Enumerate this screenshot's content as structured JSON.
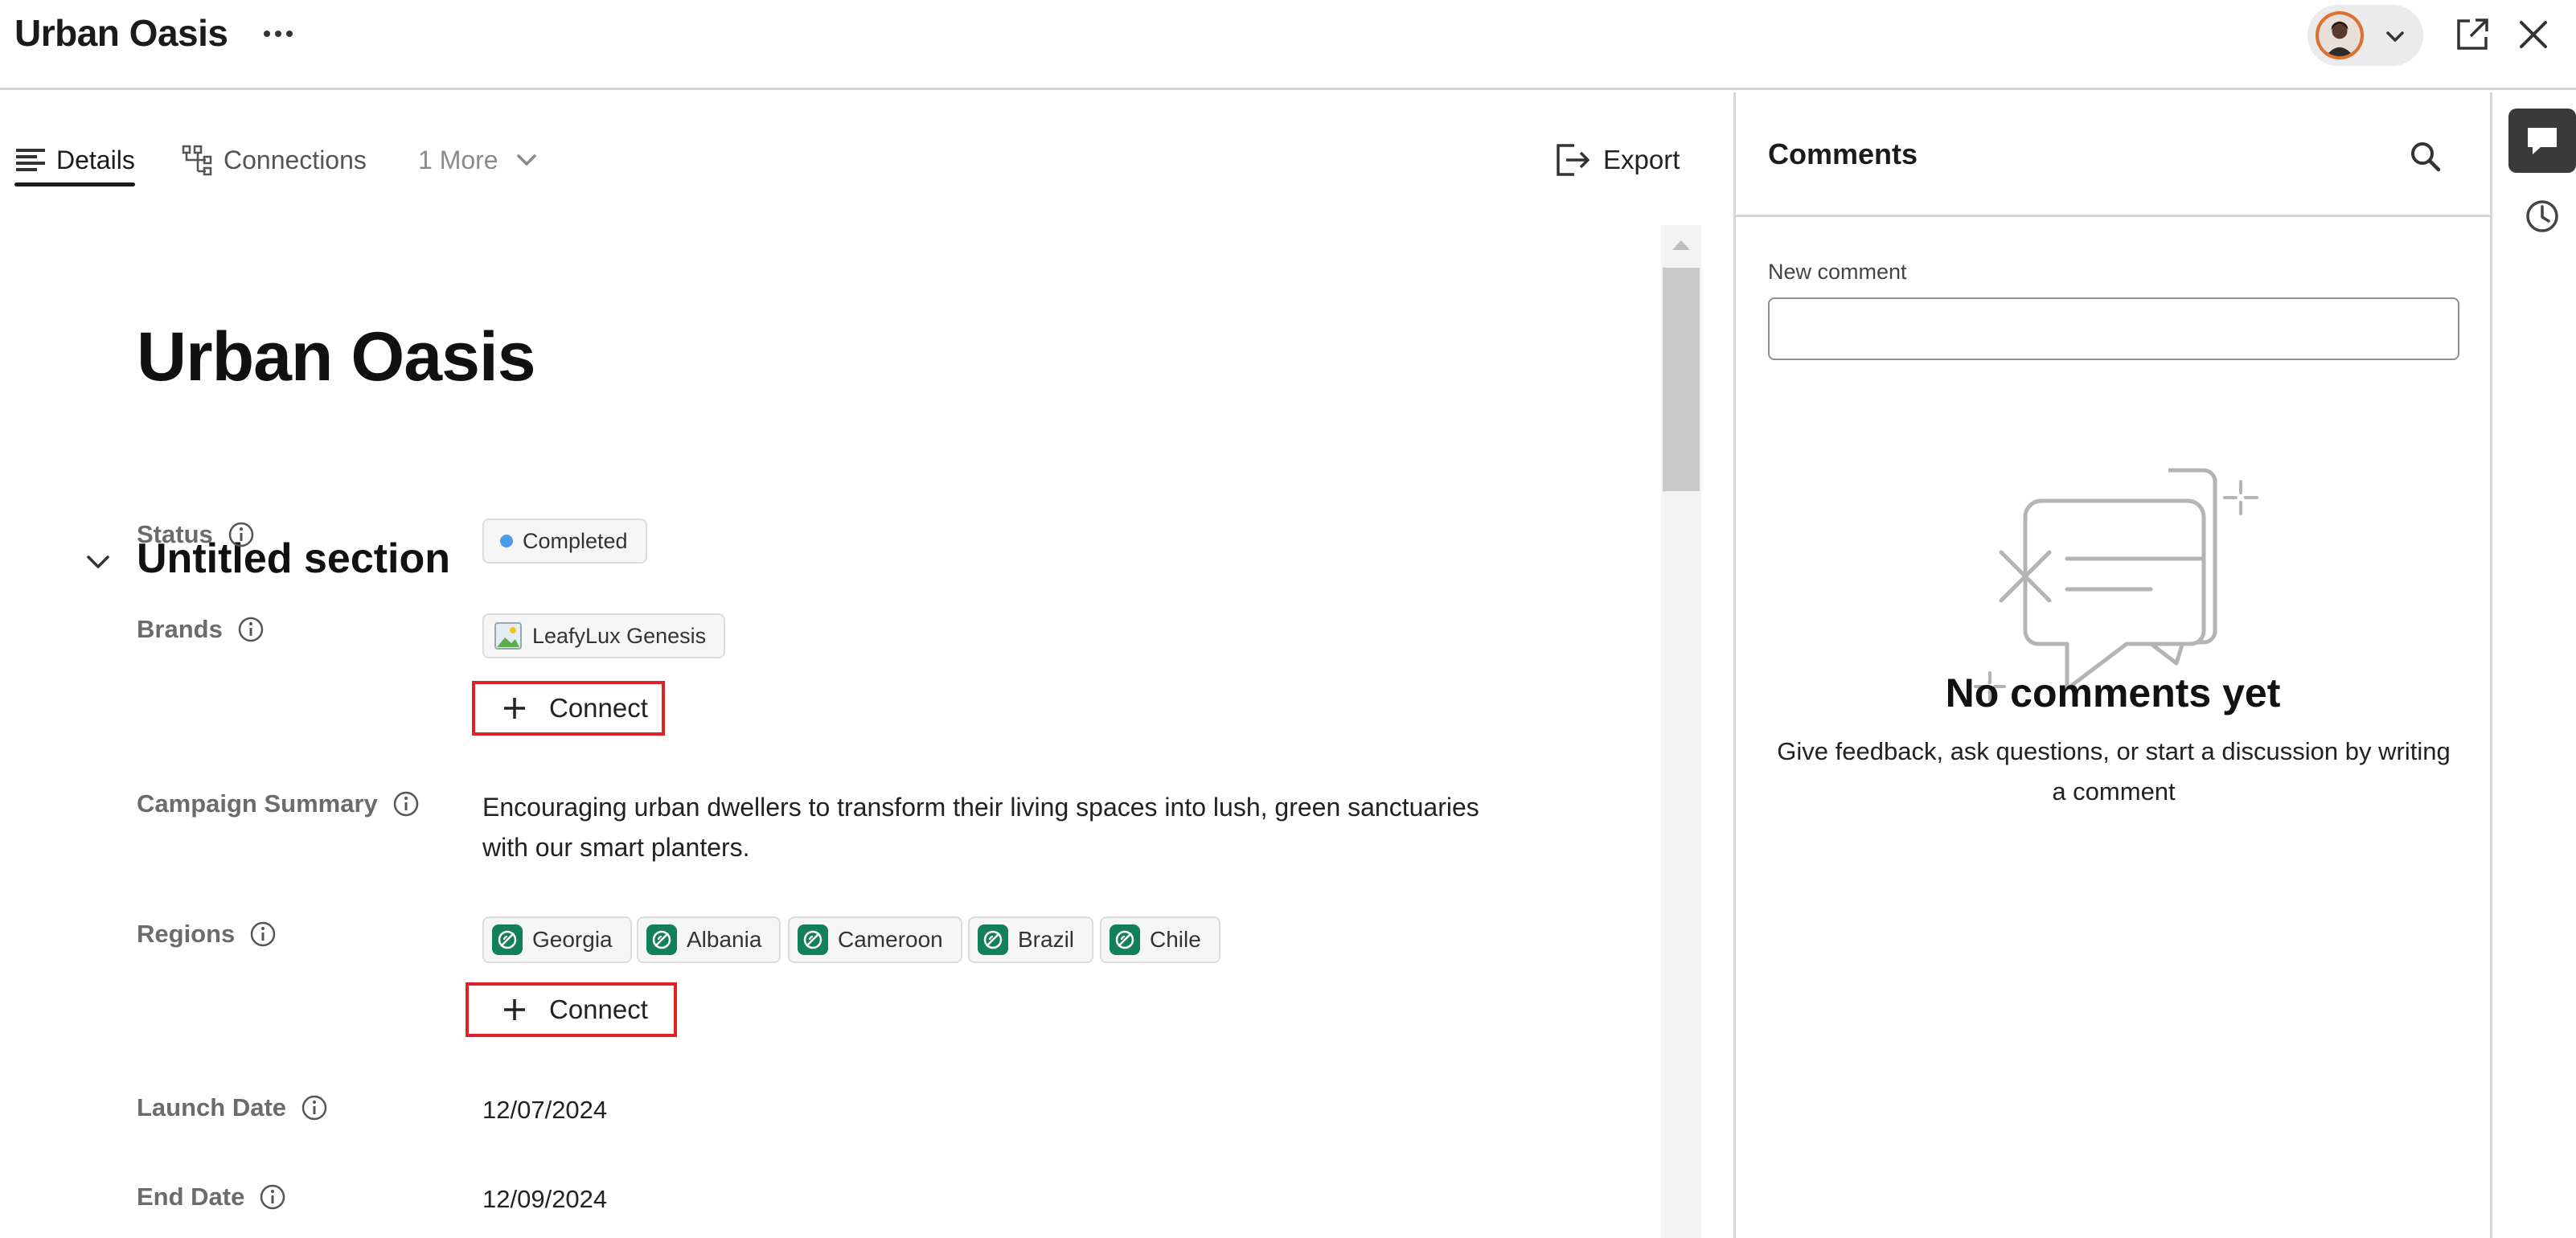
{
  "header": {
    "title": "Urban Oasis",
    "more_icon": "more-horizontal-icon",
    "user_icon": "avatar",
    "open_icon": "open-external-icon",
    "close_icon": "close-icon"
  },
  "tabs": [
    {
      "label": "Details",
      "icon": "text-align-icon",
      "active": true
    },
    {
      "label": "Connections",
      "icon": "hierarchy-icon",
      "active": false
    },
    {
      "label": "1 More",
      "icon": "chevron-down-icon",
      "active": false
    }
  ],
  "export_label": "Export",
  "page": {
    "title": "Urban Oasis",
    "section_title": "Untitled section"
  },
  "fields": {
    "status": {
      "label": "Status",
      "value": "Completed",
      "dot_color": "#4a9be8"
    },
    "brands": {
      "label": "Brands",
      "chips": [
        "LeafyLux Genesis"
      ],
      "connect_label": "Connect"
    },
    "summary": {
      "label": "Campaign Summary",
      "value": "Encouraging urban dwellers to transform their living spaces into lush, green sanctuaries with our smart planters."
    },
    "regions": {
      "label": "Regions",
      "chips": [
        "Georgia",
        "Albania",
        "Cameroon",
        "Brazil",
        "Chile"
      ],
      "connect_label": "Connect",
      "icon_color": "#12805c"
    },
    "launch_date": {
      "label": "Launch Date",
      "value": "12/07/2024"
    },
    "end_date": {
      "label": "End Date",
      "value": "12/09/2024"
    }
  },
  "comments": {
    "title": "Comments",
    "new_comment_label": "New comment",
    "new_comment_value": "",
    "empty_title": "No comments yet",
    "empty_desc": "Give feedback, ask questions, or start a discussion by writing a comment"
  },
  "colors": {
    "highlight_border": "#e02127",
    "accent_green": "#12805c",
    "status_blue": "#4a9be8"
  }
}
